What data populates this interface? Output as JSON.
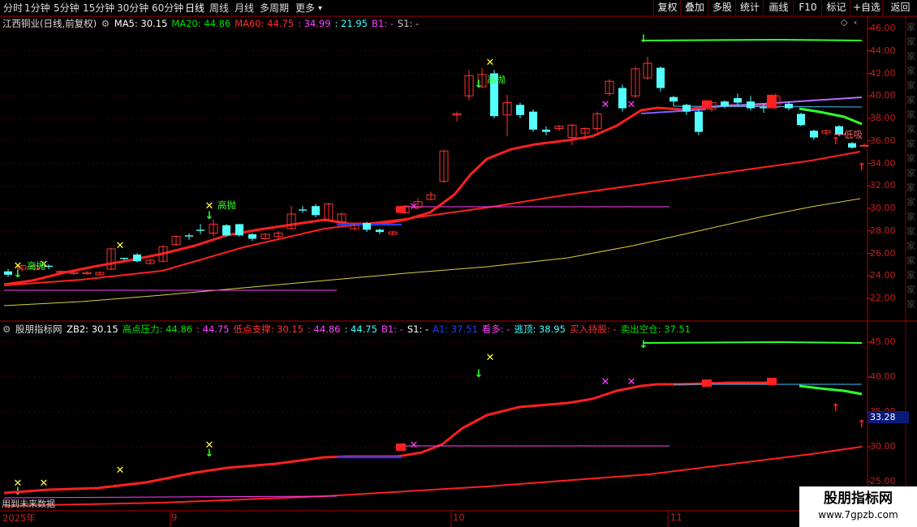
{
  "toolbar": {
    "tabs": [
      "分时",
      "1分钟",
      "5分钟",
      "15分钟",
      "30分钟",
      "60分钟",
      "日线",
      "周线",
      "月线",
      "多周期",
      "更多"
    ],
    "active_tab": "日线",
    "right_buttons": [
      "复权",
      "叠加",
      "多股",
      "统计",
      "画线",
      "F10",
      "标记",
      "+自选",
      "返回"
    ]
  },
  "main_header": {
    "title": "江西铜业(日线,前复权)",
    "items": [
      {
        "label": "MA5: 30.15",
        "color": "#ffffff"
      },
      {
        "label": "MA20: 44.86",
        "color": "#00e000"
      },
      {
        "label": "MA60: 44.75",
        "color": "#ff3030"
      },
      {
        "label": ": 34.99",
        "color": "#ff40ff"
      },
      {
        "label": ": 21.95",
        "color": "#40ffff"
      },
      {
        "label": "B1: -",
        "color": "#ff40ff"
      },
      {
        "label": "S1: -",
        "color": "#cccccc"
      }
    ]
  },
  "sub_header": {
    "title": "股朋指标网",
    "items": [
      {
        "label": "ZB2: 30.15",
        "color": "#ffffff"
      },
      {
        "label": "高点压力: 44.86",
        "color": "#00e000"
      },
      {
        "label": ": 44.75",
        "color": "#ff40ff"
      },
      {
        "label": "低点支撑: 30.15",
        "color": "#ff3030"
      },
      {
        "label": ": 44.86",
        "color": "#ff40ff"
      },
      {
        "label": ": 44.75",
        "color": "#40ffff"
      },
      {
        "label": "B1: -",
        "color": "#ff40ff"
      },
      {
        "label": "S1: -",
        "color": "#ffffff"
      },
      {
        "label": "A1: 37.51",
        "color": "#2040ff"
      },
      {
        "label": "看多: -",
        "color": "#ff40ff"
      },
      {
        "label": "逃顶: 38.95",
        "color": "#40ffff"
      },
      {
        "label": "买入持股: -",
        "color": "#ff3030"
      },
      {
        "label": "卖出空仓: 37.51",
        "color": "#00e000"
      }
    ]
  },
  "main_axis": [
    "46.00",
    "44.00",
    "42.00",
    "40.00",
    "38.00",
    "36.00",
    "34.00",
    "32.00",
    "30.00",
    "28.00",
    "26.00",
    "24.00",
    "22.00"
  ],
  "sub_axis": [
    "45.00",
    "40.00",
    "35.00",
    "30.00",
    "25.00"
  ],
  "sub_highlight": "33.28",
  "annotations": {
    "gaopao": "高抛",
    "dixi": "低吸"
  },
  "bottom": {
    "future_label": "用到未来数据",
    "dates": [
      "2025年",
      "9",
      "10",
      "11"
    ]
  },
  "watermark": {
    "line1": "股朋指标网",
    "line2": "www.7gpzb.com"
  },
  "colors": {
    "up": "#ff3232",
    "down": "#54ffff",
    "bg": "#000000",
    "grid": "#7a0000"
  }
}
